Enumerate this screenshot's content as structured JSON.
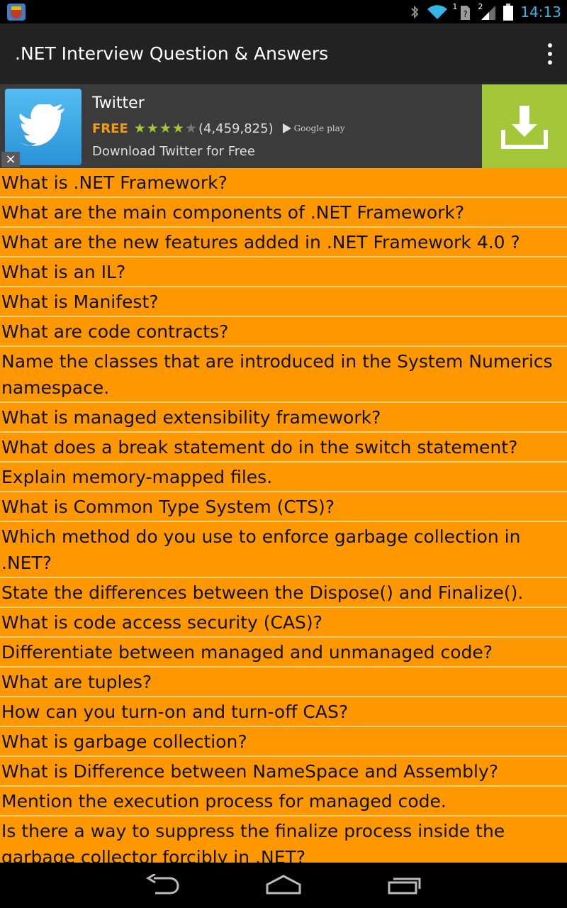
{
  "status_bar": {
    "time": "14:13",
    "sim1_label": "1",
    "sim2_label": "2",
    "icons": [
      "app-notification-icon",
      "bluetooth-icon",
      "wifi-icon",
      "no-sim-icon",
      "cell-signal-icon",
      "battery-icon"
    ]
  },
  "action_bar": {
    "title": ".NET Interview Question & Answers",
    "menu_icon": "overflow-menu-icon"
  },
  "ad": {
    "title": "Twitter",
    "price": "FREE",
    "rating": 4,
    "rating_max": 5,
    "reviews": "(4,459,825)",
    "store": "Google play",
    "subtitle": "Download Twitter for Free",
    "close": "×",
    "colors": {
      "download_bg": "#a4c639",
      "price": "#f39c12"
    }
  },
  "questions": [
    "What is .NET Framework?",
    "What are the main components of .NET Framework?",
    "What are the new features added in .NET Framework 4.0 ?",
    "What is an IL?",
    "What is Manifest?",
    "What are code contracts?",
    "Name the classes that are introduced in the System Numerics namespace.",
    "What is managed extensibility framework?",
    "What does a break statement do in the switch statement?",
    "Explain memory-mapped files.",
    "What is Common Type System (CTS)?",
    "Which method do you use to enforce garbage collection in .NET?",
    "State the differences between the Dispose() and Finalize().",
    "What is code access security (CAS)?",
    "Differentiate between managed and unmanaged code?",
    "What are tuples?",
    "How can you turn-on and turn-off CAS?",
    "What is garbage collection?",
    "What is Difference between NameSpace and Assembly?",
    "Mention the execution process for managed code.",
    "Is there a way to suppress the finalize process inside the garbage collector forcibly in .NET?"
  ],
  "nav_bar": {
    "icons": [
      "back-icon",
      "home-icon",
      "recent-apps-icon"
    ]
  },
  "theme": {
    "list_bg": "#ff9800",
    "action_bar_bg": "#222222",
    "status_accent": "#33b5e5"
  }
}
